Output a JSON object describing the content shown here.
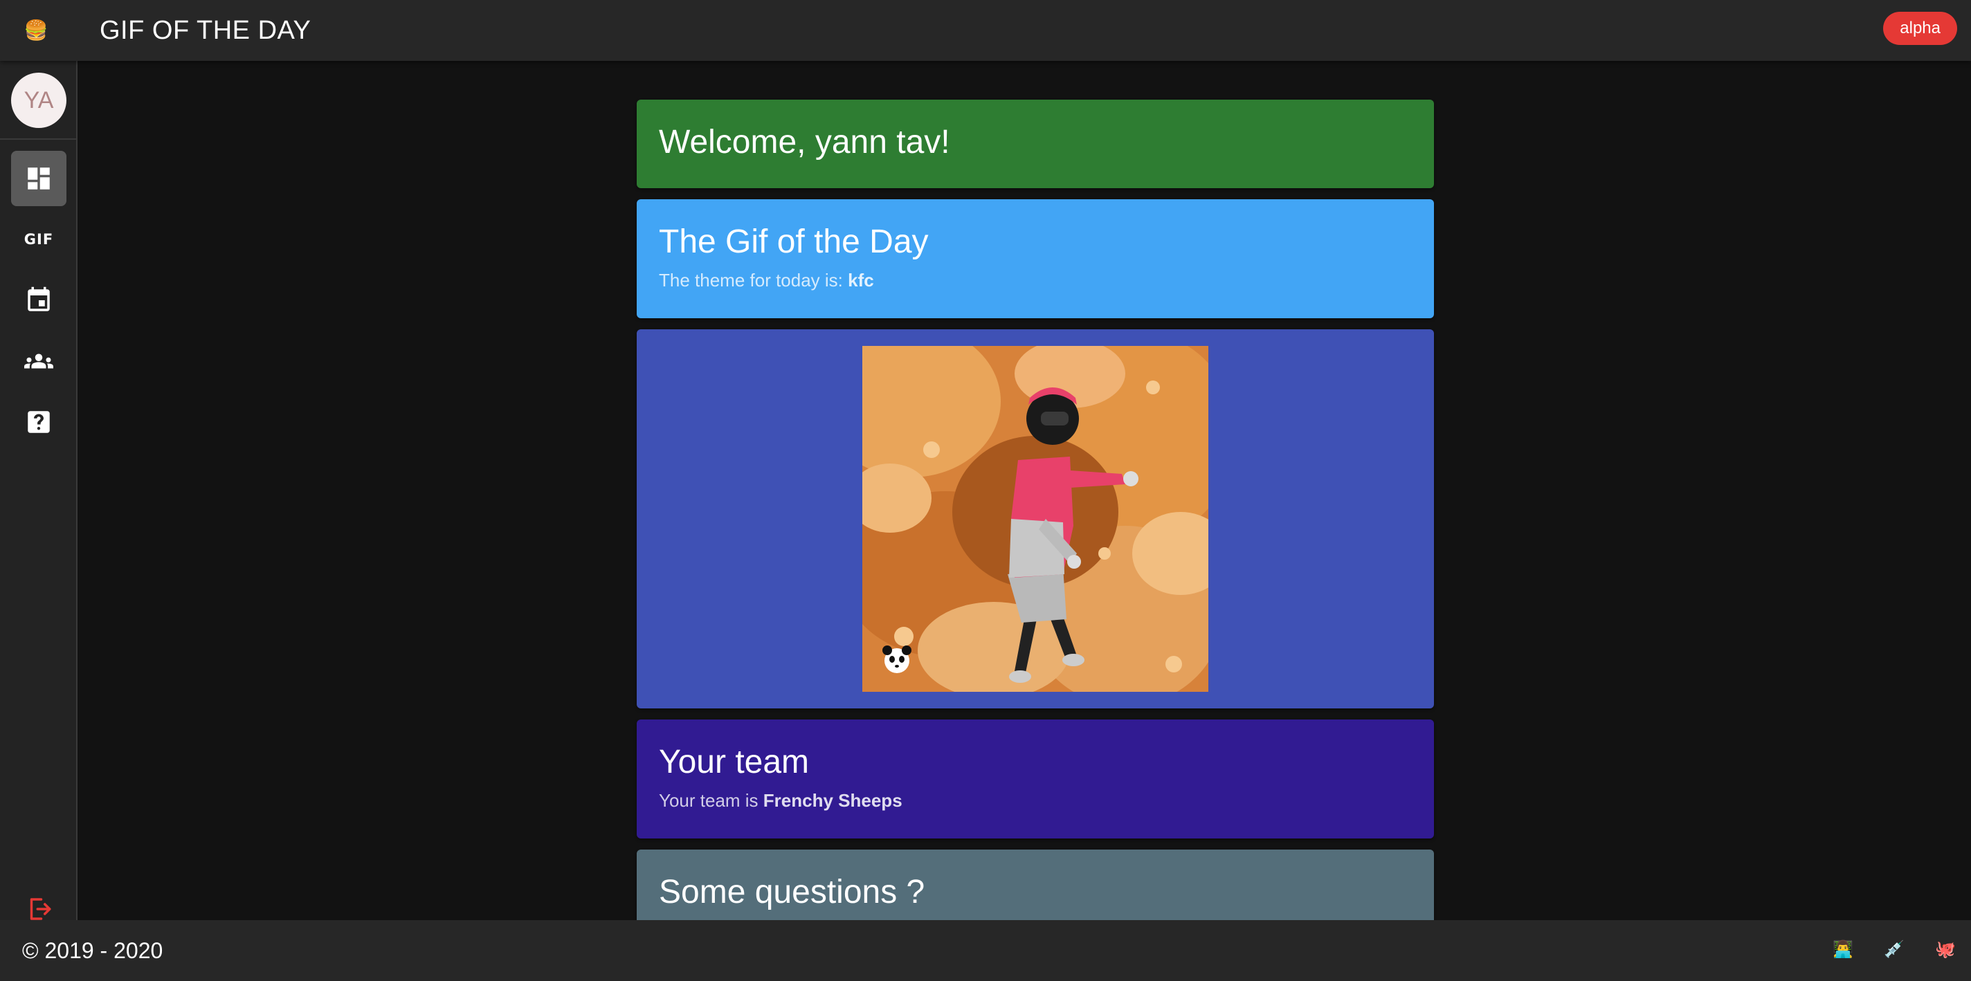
{
  "header": {
    "menu_icon": "burger-emoji-icon",
    "title": "GIF OF THE DAY",
    "badge": "alpha",
    "badge_color": "#e53935"
  },
  "sidebar": {
    "avatar_initials": "YA",
    "items": [
      {
        "icon": "dashboard-icon",
        "active": true
      },
      {
        "icon": "gif-icon",
        "label": "GIF"
      },
      {
        "icon": "calendar-icon"
      },
      {
        "icon": "group-icon"
      },
      {
        "icon": "help-icon"
      }
    ],
    "logout_icon": "logout-icon",
    "logout_color": "#e53935"
  },
  "cards": {
    "welcome": {
      "title": "Welcome, yann tav!",
      "color": "#2e7d32"
    },
    "gif_of_day": {
      "title": "The Gif of the Day",
      "subtitle_prefix": "The theme for today is: ",
      "theme": "kfc",
      "color": "#42a5f5"
    },
    "gif_display": {
      "color": "#3f51b5",
      "watermark_icon": "panda-icon"
    },
    "team": {
      "title": "Your team",
      "subtitle_prefix": "Your team is ",
      "team_name": "Frenchy Sheeps",
      "color": "#311b92"
    },
    "questions": {
      "title": "Some questions ?",
      "color": "#546e7a"
    }
  },
  "footer": {
    "copyright": "© 2019 - 2020",
    "icons": [
      "person-emoji-icon",
      "syringe-emoji-icon",
      "octopus-emoji-icon"
    ]
  }
}
